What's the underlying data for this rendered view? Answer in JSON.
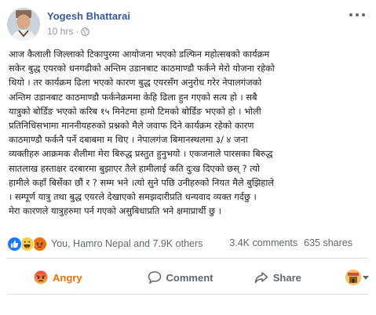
{
  "post": {
    "author": "Yogesh Bhattarai",
    "time": "10 hrs",
    "separator": "·",
    "body_lines": [
      "आज कैलाली जिल्लाको टिकापुरमा आयोजना भएको डल्फिन महोत्सबको कार्यक्रम",
      "सकेर बुद्ध एयरको धनगढीको अन्तिम उडानबाट काठमाण्डौ फर्कने मेरो योजना रहेको",
      "थियो । तर कार्यक्रम ढिला भएको कारण बुद्ध एयरसँग अनुरोध गरेर नेपालगंजको",
      "अन्तिम उडानबाट काठमाण्डौ फर्कनेक्रममा केहि ढिला हुन गएको सत्य हो । सबै",
      "यात्रुको बोर्डिङ भएको करिब १५ मिनेटमा हामो टिमको बोर्डिङ भएको हो । भोली",
      "प्रतिनिधिसभामा माननीयहरुको प्रश्नको मैले जवाफ दिने कार्यक्रम रहेको कारण",
      "काठमाण्डौ फर्कनै पर्ने दबाबमा म थिए । नेपालगंज बिमानस्थलमा ३/ ४ जना",
      "व्यक्तीहरु आक्रमक शैलीमा मेरा बिरुद्ध प्रस्तुत हुनुभयो । एकजनाले पारसका बिरुद्ध",
      "सातलाख हस्ताक्षर दरबारमा बुझाएर तैले हामीलाई कति दुःख दिएको छस् ? त्यो",
      "हामीले कहाँ बिर्सेका छौं र ? सम्म भने ।त्यो सुने पछि उनीहरुको नियत मैले बुझिहाले",
      "। सम्पूर्ण यात्रु तथा बुद्ध एयरले देखाएको समझदारीप्रति धन्यवाद व्यक्त गर्दछु ।",
      "मेरा कारणले यात्रुहरुमा पर्न गएको असुबिधाप्रति भने क्षमाप्रार्थी छु ।"
    ]
  },
  "reactions": {
    "summary": "You, Hamro Nepal and 7.9K others",
    "comments": "3.4K comments",
    "shares": "635 shares",
    "icons": [
      "like-icon",
      "haha-icon",
      "angry-icon"
    ]
  },
  "actions": {
    "angry_label": "Angry",
    "comment_label": "Comment",
    "share_label": "Share"
  },
  "colors": {
    "author_link": "#385898",
    "meta_gray": "#90949c",
    "angry": "#e9710f",
    "like_blue": "#1877f2",
    "action_gray": "#606770"
  }
}
